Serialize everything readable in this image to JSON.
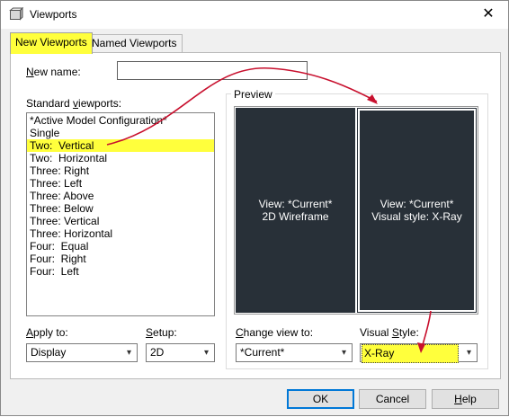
{
  "window": {
    "title": "Viewports",
    "close_glyph": "✕"
  },
  "tabs": [
    {
      "label": "New Viewports",
      "active": true
    },
    {
      "label": "Named Viewports",
      "active": false
    }
  ],
  "new_name": {
    "label_u": "N",
    "label_rest": "ew name:",
    "value": ""
  },
  "standard": {
    "label_a": "Standard ",
    "label_u": "v",
    "label_b": "iewports:",
    "items": [
      "*Active Model Configuration*",
      "Single",
      "Two:  Vertical",
      "Two:  Horizontal",
      "Three: Right",
      "Three: Left",
      "Three: Above",
      "Three: Below",
      "Three: Vertical",
      "Three: Horizontal",
      "Four:  Equal",
      "Four:  Right",
      "Four:  Left"
    ],
    "selected_index": 2
  },
  "preview": {
    "title": "Preview",
    "left": {
      "line1": "View: *Current*",
      "line2": "2D Wireframe"
    },
    "right": {
      "line1": "View: *Current*",
      "line2": "Visual style: X-Ray"
    }
  },
  "apply_to": {
    "label_u": "A",
    "label_rest": "pply to:",
    "value": "Display"
  },
  "setup": {
    "label_u": "S",
    "label_rest": "etup:",
    "value": "2D"
  },
  "change_view": {
    "label_u": "C",
    "label_rest": "hange view to:",
    "value": "*Current*"
  },
  "visual_style": {
    "label_a": "Visual ",
    "label_u": "S",
    "label_rest": "tyle:",
    "value": "X-Ray"
  },
  "buttons": {
    "ok": "OK",
    "cancel": "Cancel",
    "help_u": "H",
    "help_rest": "elp"
  },
  "colors": {
    "highlight": "#ffff3c",
    "annotation_arrow": "#c8102e",
    "viewport_bg": "#283038"
  },
  "icons": {
    "dropdown": "▾"
  }
}
